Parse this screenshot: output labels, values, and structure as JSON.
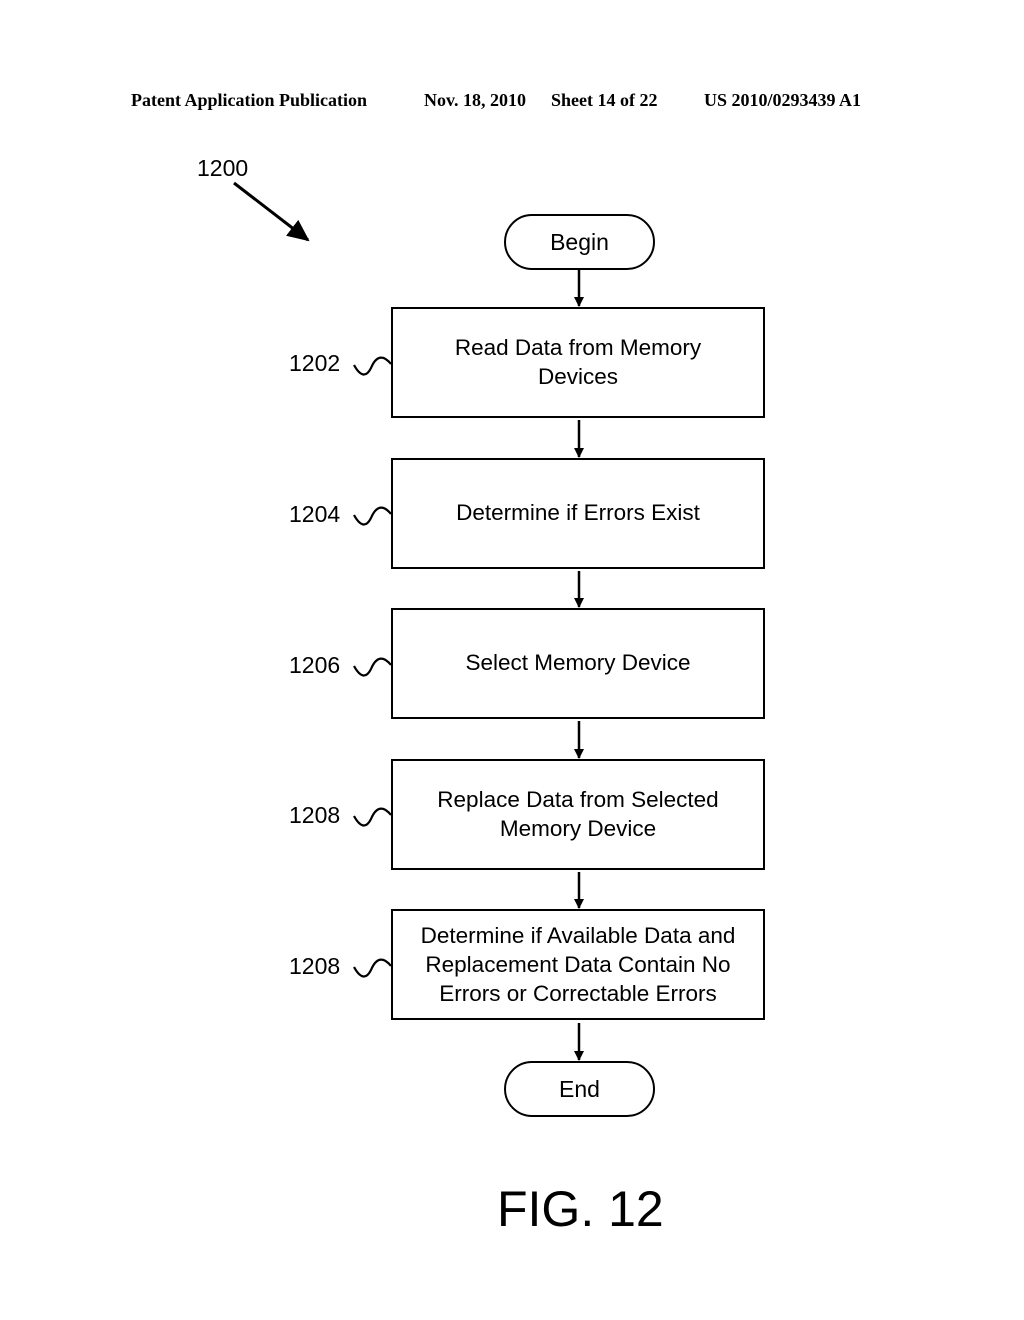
{
  "header": {
    "publication": "Patent Application Publication",
    "date": "Nov. 18, 2010",
    "sheet": "Sheet 14 of 22",
    "number": "US 2010/0293439 A1"
  },
  "figure": {
    "reference": "1200",
    "caption": "FIG. 12"
  },
  "flowchart": {
    "start": "Begin",
    "end": "End",
    "steps": [
      {
        "ref": "1202",
        "lines": [
          "Read Data from Memory",
          "Devices"
        ]
      },
      {
        "ref": "1204",
        "lines": [
          "Determine if Errors Exist"
        ]
      },
      {
        "ref": "1206",
        "lines": [
          "Select Memory Device"
        ]
      },
      {
        "ref": "1208",
        "lines": [
          "Replace Data from Selected",
          "Memory Device"
        ]
      },
      {
        "ref": "1208",
        "lines": [
          "Determine if Available Data and",
          "Replacement Data Contain No",
          "Errors or Correctable Errors"
        ]
      }
    ]
  }
}
